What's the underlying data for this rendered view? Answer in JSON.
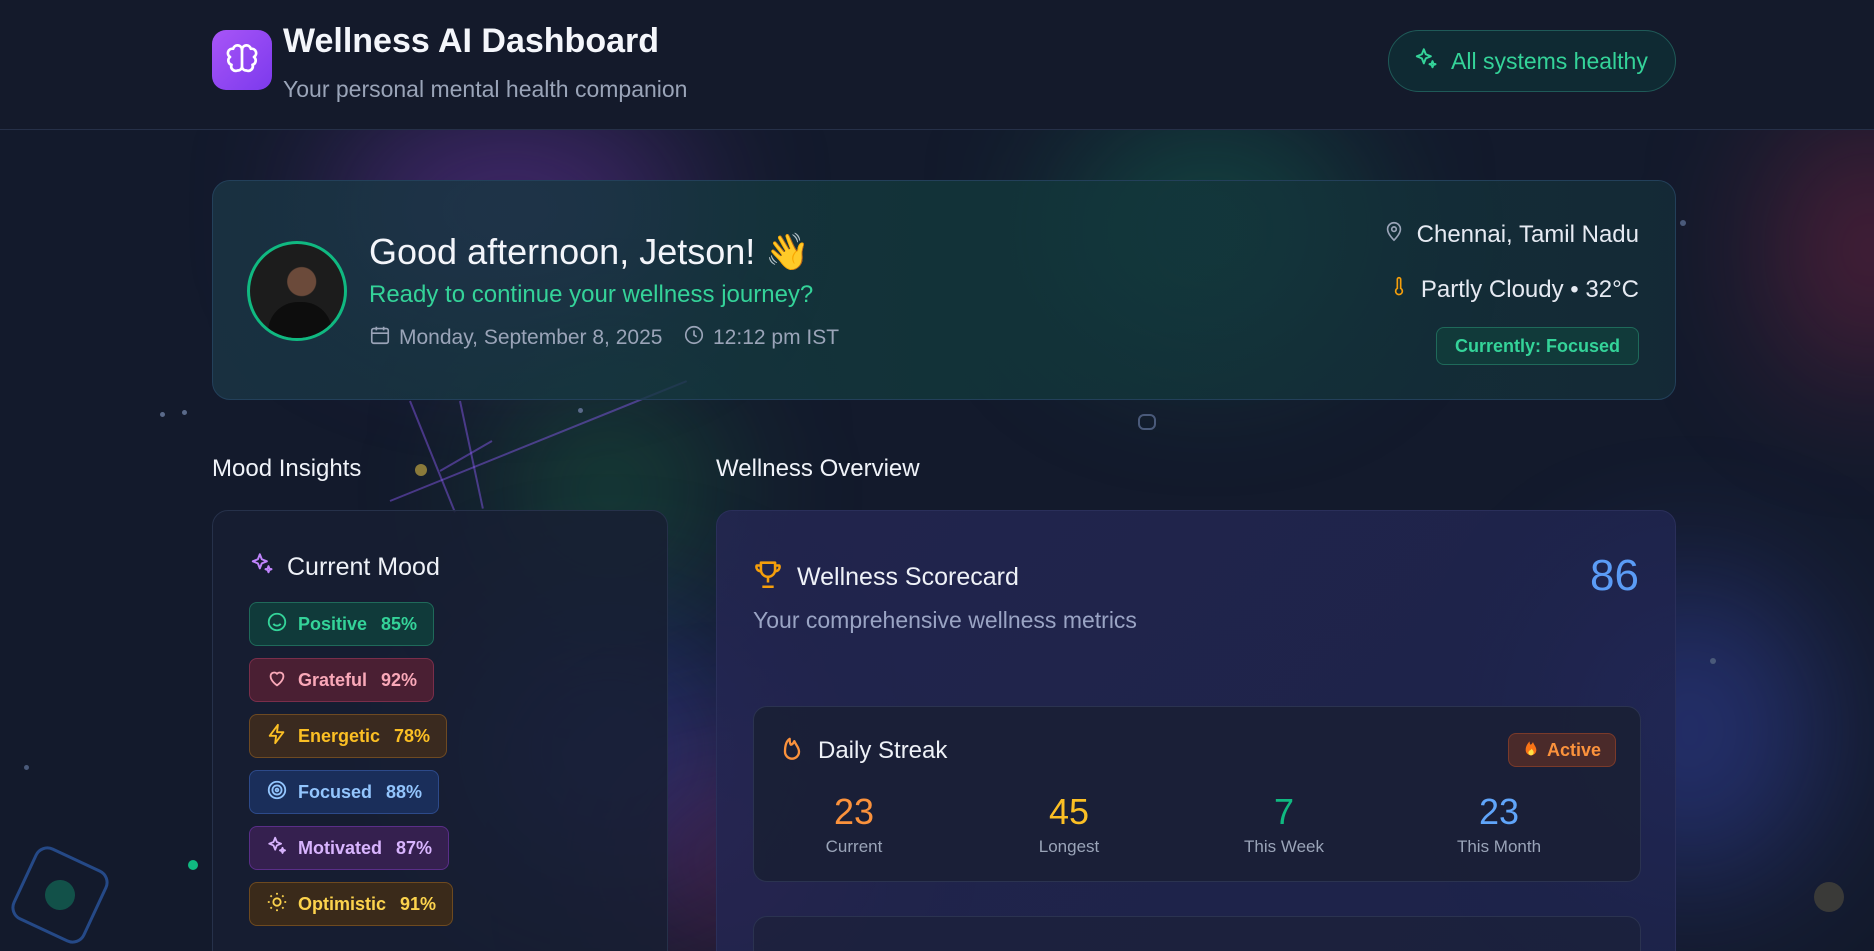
{
  "app": {
    "title": "Wellness AI Dashboard",
    "subtitle": "Your personal mental health companion",
    "status": "All systems healthy"
  },
  "welcome": {
    "greeting": "Good afternoon, Jetson! 👋",
    "tagline": "Ready to continue your wellness journey?",
    "date": "Monday, September 8, 2025",
    "time": "12:12 pm IST",
    "location": "Chennai, Tamil Nadu",
    "weather": "Partly Cloudy • 32°C",
    "current_state": "Currently: Focused"
  },
  "sections": {
    "mood_insights": "Mood Insights",
    "wellness_overview": "Wellness Overview"
  },
  "mood": {
    "heading": "Current Mood",
    "chips": [
      {
        "label": "Positive",
        "value": "85%",
        "icon": "smile-icon",
        "color": "#34d399"
      },
      {
        "label": "Grateful",
        "value": "92%",
        "icon": "heart-icon",
        "color": "#f9a8b8"
      },
      {
        "label": "Energetic",
        "value": "78%",
        "icon": "bolt-icon",
        "color": "#fbbf24"
      },
      {
        "label": "Focused",
        "value": "88%",
        "icon": "target-icon",
        "color": "#93c5fd"
      },
      {
        "label": "Motivated",
        "value": "87%",
        "icon": "sparkles-icon",
        "color": "#d8b4fe"
      },
      {
        "label": "Optimistic",
        "value": "91%",
        "icon": "sun-icon",
        "color": "#fcd34d"
      }
    ]
  },
  "scorecard": {
    "title": "Wellness Scorecard",
    "subtitle": "Your comprehensive wellness metrics",
    "score": "86"
  },
  "streak": {
    "title": "Daily Streak",
    "badge": "Active",
    "stats": [
      {
        "value": "23",
        "label": "Current",
        "color": "#fb923c"
      },
      {
        "value": "45",
        "label": "Longest",
        "color": "#fbbf24"
      },
      {
        "value": "7",
        "label": "This Week",
        "color": "#10b981"
      },
      {
        "value": "23",
        "label": "This Month",
        "color": "#60a5fa"
      }
    ]
  },
  "colors": {
    "accent_green": "#34d399",
    "accent_purple": "#a855f7",
    "accent_blue": "#5b9cf6",
    "background": "#131a2c"
  }
}
